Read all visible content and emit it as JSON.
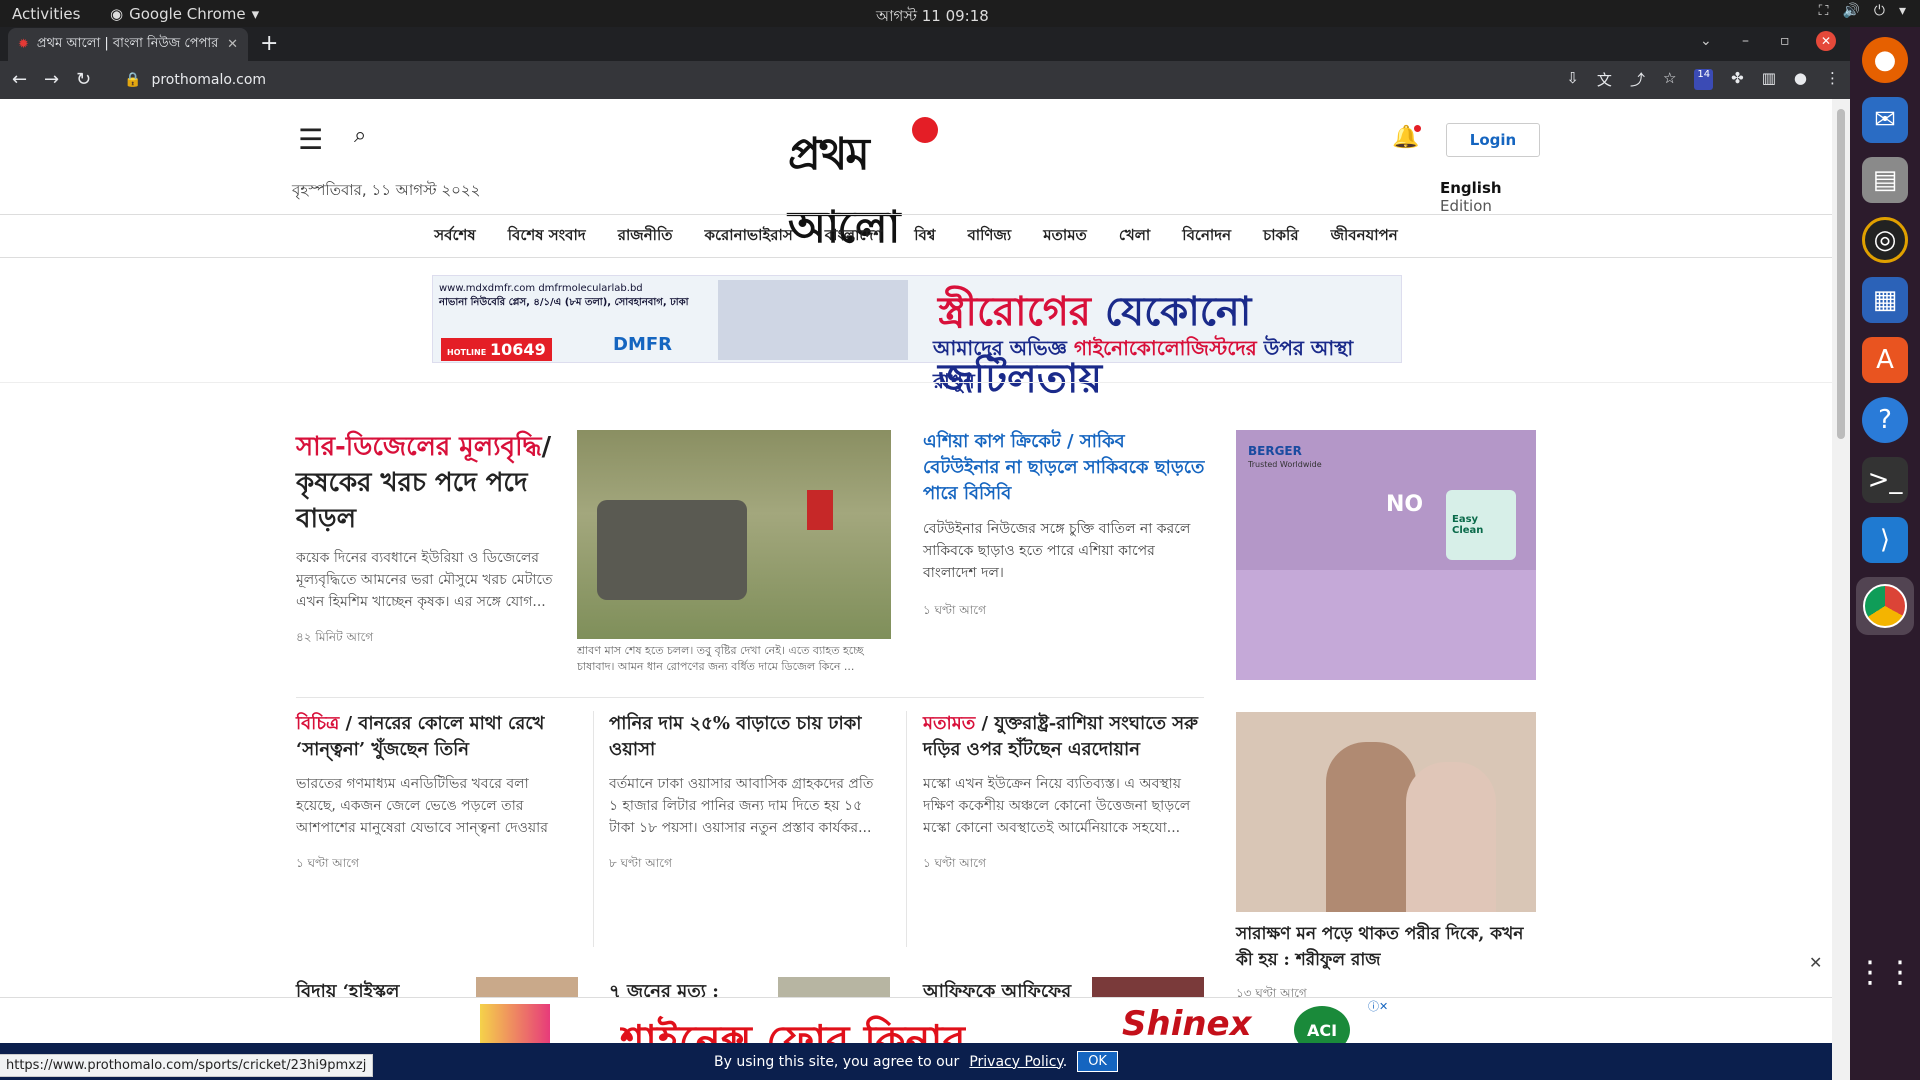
{
  "os": {
    "activities": "Activities",
    "app_name": "Google Chrome",
    "clock": "আগস্ট 11  09:18"
  },
  "browser": {
    "tab_title": "প্রথম আলো | বাংলা নিউজ পেপার",
    "url": "prothomalo.com",
    "status_url": "https://www.prothomalo.com/sports/cricket/23hi9pmxzj",
    "extension_badge": "14"
  },
  "site": {
    "logo_text": "প্রথম আলো",
    "date": "বৃহস্পতিবার, ১১ আগস্ট ২০২২",
    "login": "Login",
    "edition_english": "English",
    "edition_label": "Edition",
    "nav": [
      "সর্বশেষ",
      "বিশেষ সংবাদ",
      "রাজনীতি",
      "করোনাভাইরাস",
      "বাংলাদেশ",
      "বিশ্ব",
      "বাণিজ্য",
      "মতামত",
      "খেলা",
      "বিনোদন",
      "চাকরি",
      "জীবনযাপন"
    ]
  },
  "ad_top": {
    "web": "www.mdxdmfr.com  dmfrmolecularlab.bd",
    "address": "নাভানা নিউবেরি প্লেস, ৪/১/এ (৮ম তলা), সোবহানবাগ, ঢাকা",
    "hotline_label": "HOTLINE",
    "hotline": "10649",
    "brand": "DMFR",
    "headline_red": "স্ত্রীরোগের",
    "headline_blue": "যেকোনো জটিলতায়",
    "sub_blue_1": "আমাদের অভিজ্ঞ",
    "sub_red": "গাইনোকোলোজিস্টদের",
    "sub_blue_2": "উপর আস্থা রাখুন"
  },
  "lead": {
    "kicker": "সার-ডিজেলের মূল্যবৃদ্ধি",
    "slash": "/",
    "title": "কৃষকের খরচ পদে পদে বাড়ল",
    "summary": "কয়েক দিনের ব্যবধানে ইউরিয়া ও ডিজেলের মূল্যবৃদ্ধিতে আমনের ভরা মৌসুমে খরচ মেটাতে এখন হিমশিম খাচ্ছেন কৃষক। এর সঙ্গে যোগ...",
    "time": "৪২ মিনিট আগে",
    "caption": "শ্রাবণ মাস শেষ হতে চলল। তবু বৃষ্টির দেখা নেই। এতে ব্যাহত হচ্ছে চাষাবাদ। আমন ধান রোপণের জন্য বর্ধিত দামে ডিজেল কিনে ..."
  },
  "cricket": {
    "title": "এশিয়া কাপ ক্রিকেট / সাকিব বেটউইনার না ছাড়লে সাকিবকে ছাড়তে পারে বিসিবি",
    "summary": "বেটউইনার নিউজের সঙ্গে চুক্তি বাতিল না করলে সাকিবকে ছাড়াও হতে পারে এশিয়া কাপের বাংলাদেশ দল।",
    "time": "১ ঘণ্টা আগে"
  },
  "row2": [
    {
      "kicker": "বিচিত্র",
      "slash": " / ",
      "title": "বানরের কোলে মাথা রেখে ‘সান্ত্বনা’ খুঁজছেন তিনি",
      "summary": "ভারতের গণমাধ্যম এনডিটিভির খবরে বলা হয়েছে, একজন জেলে ভেঙে পড়লে তার আশপাশের মানুষেরা যেভাবে সান্ত্বনা দেওয়ার চেষ্টা করে, ...",
      "time": "১ ঘণ্টা আগে"
    },
    {
      "kicker": "",
      "slash": "",
      "title": "পানির দাম ২৫% বাড়াতে চায় ঢাকা ওয়াসা",
      "summary": "বর্তমানে ঢাকা ওয়াসার আবাসিক গ্রাহকদের প্রতি ১ হাজার লিটার পানির জন্য দাম দিতে হয় ১৫ টাকা ১৮ পয়সা। ওয়াসার নতুন প্রস্তাব কার্যকর...",
      "time": "৮ ঘণ্টা আগে"
    },
    {
      "kicker": "মতামত",
      "slash": " / ",
      "title": "যুক্তরাষ্ট্র-রাশিয়া সংঘাতে সরু দড়ির ওপর হাঁটছেন এরদোয়ান",
      "summary": "মস্কো এখন ইউক্রেন নিয়ে ব্যতিব্যস্ত। এ অবস্থায় দক্ষিণ ককেশীয় অঞ্চলে কোনো উত্তেজনা ছাড়লে মস্কো কোনো অবস্থাতেই আর্মেনিয়াকে সহযো...",
      "time": "১ ঘণ্টা আগে"
    }
  ],
  "row3": [
    "বিদায় ‘হাইস্কুল",
    "৭ জনের মৃত্যু :",
    "আফিফকে আফিফের"
  ],
  "side": {
    "ad_brand": "BERGER",
    "ad_tag": "Trusted Worldwide",
    "ad_no": "NO",
    "ad_product": "Easy Clean",
    "story_title": "সারাক্ষণ মন পড়ে থাকত পরীর দিকে, কখন কী হয় : শরীফুল রাজ",
    "story_time": "১৩ ঘণ্টা আগে"
  },
  "bottom_ad": {
    "text": "শাইনেক্স ফোর কিনার",
    "brand": "Shinex",
    "aci": "ACI"
  },
  "cookie": {
    "text": "By using this site, you agree to our",
    "link": "Privacy Policy",
    "dot": ".",
    "ok": "OK"
  }
}
